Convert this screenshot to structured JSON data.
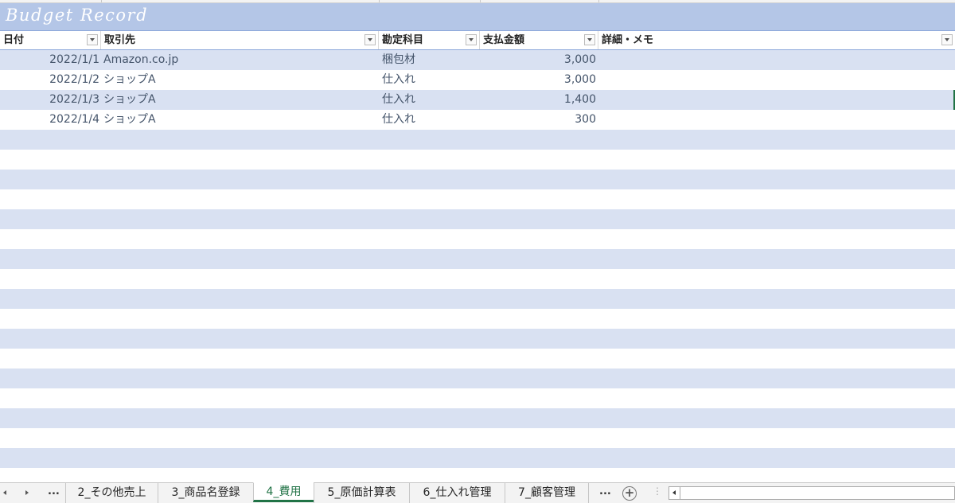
{
  "sheet": {
    "title": "Budget Record",
    "columns": [
      {
        "key": "date",
        "label": "日付"
      },
      {
        "key": "vendor",
        "label": "取引先"
      },
      {
        "key": "account",
        "label": "勘定科目"
      },
      {
        "key": "amount",
        "label": "支払金額"
      },
      {
        "key": "memo",
        "label": "詳細・メモ"
      }
    ],
    "rows": [
      {
        "date": "2022/1/1",
        "vendor": "Amazon.co.jp",
        "account": "梱包材",
        "amount": "3,000",
        "memo": ""
      },
      {
        "date": "2022/1/2",
        "vendor": "ショップA",
        "account": "仕入れ",
        "amount": "3,000",
        "memo": ""
      },
      {
        "date": "2022/1/3",
        "vendor": "ショップA",
        "account": "仕入れ",
        "amount": "1,400",
        "memo": ""
      },
      {
        "date": "2022/1/4",
        "vendor": "ショップA",
        "account": "仕入れ",
        "amount": "300",
        "memo": ""
      }
    ],
    "colors": {
      "band": "#d9e1f2",
      "title_band": "#b4c6e7",
      "accent": "#217346"
    }
  },
  "tabs": {
    "ellipsis_left": "...",
    "ellipsis_right": "...",
    "items": [
      {
        "label": "2_その他売上",
        "active": false
      },
      {
        "label": "3_商品名登録",
        "active": false
      },
      {
        "label": "4_費用",
        "active": true
      },
      {
        "label": "5_原価計算表",
        "active": false
      },
      {
        "label": "6_仕入れ管理",
        "active": false
      },
      {
        "label": "7_顧客管理",
        "active": false
      }
    ],
    "add_symbol": "+",
    "split_symbol": "⋮"
  }
}
